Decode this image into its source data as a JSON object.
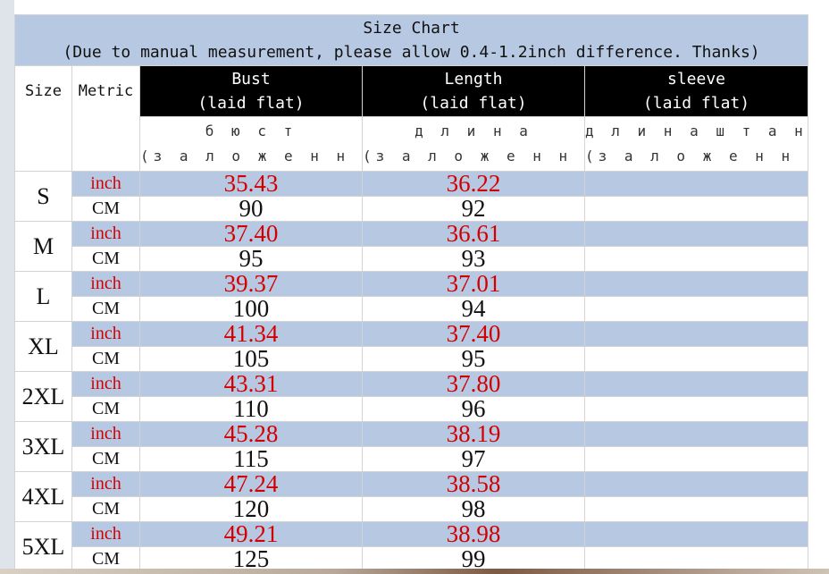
{
  "title": "Size Chart",
  "subtitle": "(Due to manual measurement, please allow 0.4-1.2inch difference. Thanks)",
  "headers": {
    "size": "Size",
    "metric": "Metric",
    "columns": [
      {
        "name": "Bust",
        "sub": "(laid flat)",
        "ru_name": "б ю с т",
        "ru_sub": "(з а л о ж е н н ы й)"
      },
      {
        "name": "Length",
        "sub": "(laid flat)",
        "ru_name": "д л и н а",
        "ru_sub": "(з а л о ж е н н ы й)"
      },
      {
        "name": "sleeve",
        "sub": "(laid flat)",
        "ru_name": "д л и н а ш т а н о в",
        "ru_sub": "(з а л о ж е н н ы й)"
      }
    ]
  },
  "units": {
    "inch": "inch",
    "cm": "CM"
  },
  "rows": [
    {
      "size": "S",
      "bust_inch": "35.43",
      "bust_cm": "90",
      "length_inch": "36.22",
      "length_cm": "92",
      "sleeve_inch": "",
      "sleeve_cm": ""
    },
    {
      "size": "M",
      "bust_inch": "37.40",
      "bust_cm": "95",
      "length_inch": "36.61",
      "length_cm": "93",
      "sleeve_inch": "",
      "sleeve_cm": ""
    },
    {
      "size": "L",
      "bust_inch": "39.37",
      "bust_cm": "100",
      "length_inch": "37.01",
      "length_cm": "94",
      "sleeve_inch": "",
      "sleeve_cm": ""
    },
    {
      "size": "XL",
      "bust_inch": "41.34",
      "bust_cm": "105",
      "length_inch": "37.40",
      "length_cm": "95",
      "sleeve_inch": "",
      "sleeve_cm": ""
    },
    {
      "size": "2XL",
      "bust_inch": "43.31",
      "bust_cm": "110",
      "length_inch": "37.80",
      "length_cm": "96",
      "sleeve_inch": "",
      "sleeve_cm": ""
    },
    {
      "size": "3XL",
      "bust_inch": "45.28",
      "bust_cm": "115",
      "length_inch": "38.19",
      "length_cm": "97",
      "sleeve_inch": "",
      "sleeve_cm": ""
    },
    {
      "size": "4XL",
      "bust_inch": "47.24",
      "bust_cm": "120",
      "length_inch": "38.58",
      "length_cm": "98",
      "sleeve_inch": "",
      "sleeve_cm": ""
    },
    {
      "size": "5XL",
      "bust_inch": "49.21",
      "bust_cm": "125",
      "length_inch": "38.98",
      "length_cm": "99",
      "sleeve_inch": "",
      "sleeve_cm": ""
    }
  ],
  "colors": {
    "band": "#b7c9e2",
    "header_black": "#000000",
    "inch_text": "#d40000"
  }
}
